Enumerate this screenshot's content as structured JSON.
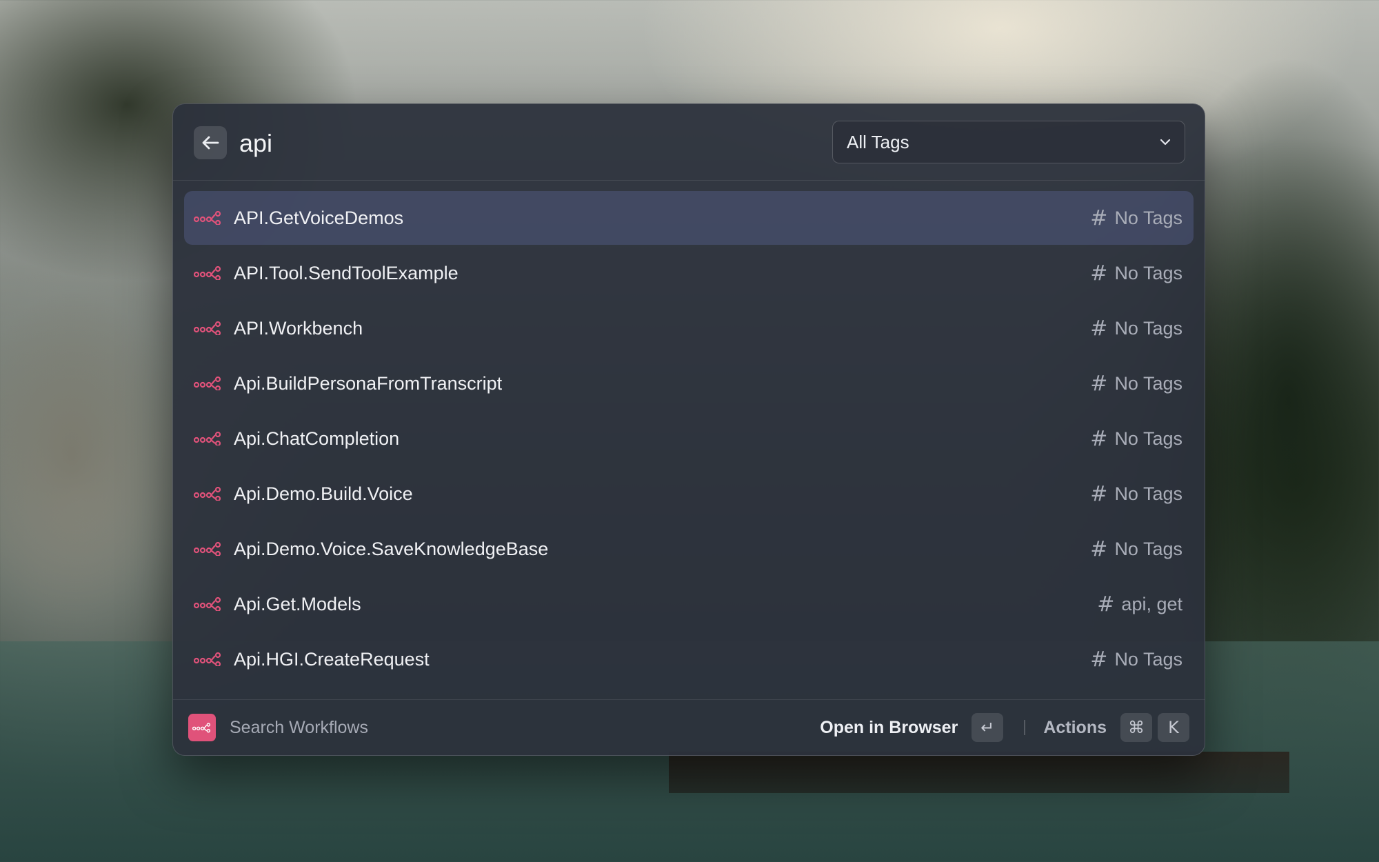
{
  "search": {
    "value": "api",
    "back_icon": "arrow-left-icon"
  },
  "tag_filter": {
    "selected": "All Tags",
    "icon": "chevron-down-icon"
  },
  "results": [
    {
      "name": "API.GetVoiceDemos",
      "tags": "No Tags",
      "selected": true
    },
    {
      "name": "API.Tool.SendToolExample",
      "tags": "No Tags"
    },
    {
      "name": "API.Workbench",
      "tags": "No Tags"
    },
    {
      "name": "Api.BuildPersonaFromTranscript",
      "tags": "No Tags"
    },
    {
      "name": "Api.ChatCompletion",
      "tags": "No Tags"
    },
    {
      "name": "Api.Demo.Build.Voice",
      "tags": "No Tags"
    },
    {
      "name": "Api.Demo.Voice.SaveKnowledgeBase",
      "tags": "No Tags"
    },
    {
      "name": "Api.Get.Models",
      "tags": "api, get"
    },
    {
      "name": "Api.HGI.CreateRequest",
      "tags": "No Tags"
    }
  ],
  "row_icon": "workflow-icon",
  "tag_icon": "hash-icon",
  "footer": {
    "title": "Search Workflows",
    "primary_action": "Open in Browser",
    "primary_shortcut": "↵",
    "secondary_action": "Actions",
    "secondary_shortcut_mod": "⌘",
    "secondary_shortcut_key": "K"
  },
  "colors": {
    "accent": "#e0527a",
    "selection": "#4b5478"
  }
}
